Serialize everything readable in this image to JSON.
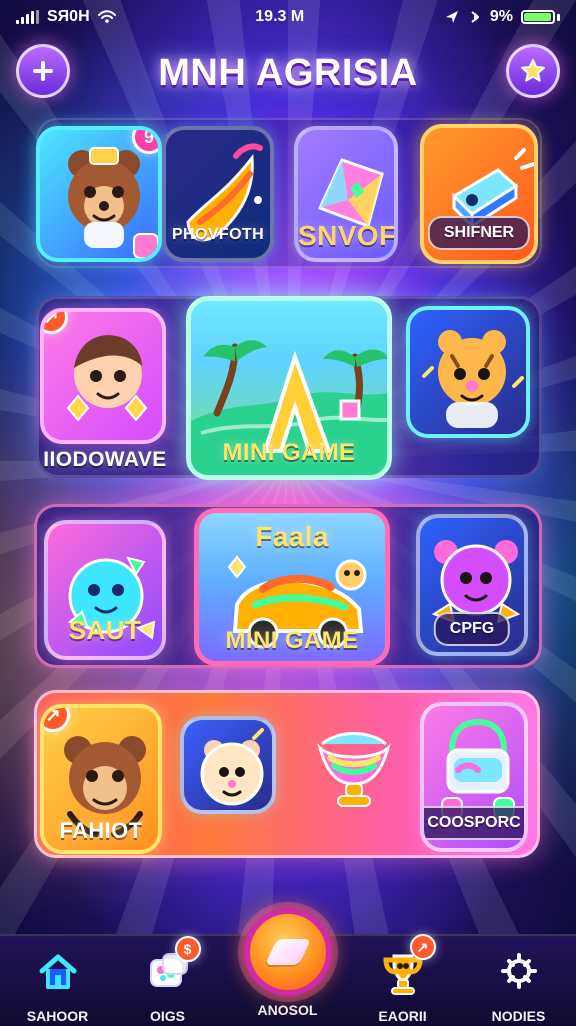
{
  "status_bar": {
    "carrier": "SЯ0H",
    "time": "19.3 M",
    "battery_text": "9%",
    "battery_level": 0.9,
    "signal_level": 0.85
  },
  "header": {
    "title": "MNH AGRISIA",
    "left_icon": "plus-icon",
    "right_icon": "star-icon"
  },
  "rows": [
    {
      "tiles": [
        {
          "name": "tile-bear",
          "label": "",
          "badge": "9",
          "icon": "bear-character-icon"
        },
        {
          "name": "tile-phovfoth",
          "label": "PHOVFOTH",
          "icon": "slide-icon"
        },
        {
          "name": "tile-snvof",
          "label": "SNVOF",
          "icon": "gem-icon"
        },
        {
          "name": "tile-shifner",
          "label": "SHIFNER",
          "icon": "crystal-block-icon"
        }
      ]
    },
    {
      "tiles": [
        {
          "name": "tile-iiodowave",
          "label": "IIODOWAVE",
          "badge": "↗",
          "icon": "boy-character-icon"
        },
        {
          "name": "tile-mini-game-1",
          "label": "MINI GAME",
          "icon": "island-letter-a-icon"
        },
        {
          "name": "tile-tiger",
          "label": "",
          "icon": "tiger-cub-icon"
        }
      ]
    },
    {
      "tiles": [
        {
          "name": "tile-saut",
          "label": "SAUT",
          "icon": "blob-monster-icon"
        },
        {
          "name": "tile-mini-game-2",
          "label": "MINI GAME",
          "subtitle": "Faala",
          "icon": "rainbow-car-icon"
        },
        {
          "name": "tile-cpfg",
          "label": "CPFG",
          "icon": "purple-monster-icon"
        }
      ]
    },
    {
      "tiles": [
        {
          "name": "tile-fahiot",
          "label": "FAHIOT",
          "badge": "↗",
          "icon": "monkey-character-icon"
        },
        {
          "name": "tile-hamster",
          "label": "",
          "icon": "hamster-icon"
        },
        {
          "name": "tile-rainbow-cup",
          "label": "",
          "icon": "rainbow-cup-icon"
        },
        {
          "name": "tile-coosporc",
          "label": "COOSPORC",
          "icon": "toy-robot-icon"
        }
      ]
    }
  ],
  "bottom_nav": {
    "items": [
      {
        "label": "SAHOOR",
        "icon": "home-icon",
        "active": true
      },
      {
        "label": "OIGS",
        "icon": "puzzle-cards-icon",
        "badge": "$"
      },
      {
        "label": "ANOSOL",
        "icon": "diamond-icon"
      },
      {
        "label": "EAORII",
        "icon": "trophy-icon",
        "badge": "↗"
      },
      {
        "label": "NODIES",
        "icon": "settings-icon"
      }
    ]
  },
  "colors": {
    "accent_purple": "#6b2bd9",
    "accent_pink": "#ff3ea8",
    "accent_orange": "#ff8f1f",
    "accent_cyan": "#3fe6ff"
  }
}
